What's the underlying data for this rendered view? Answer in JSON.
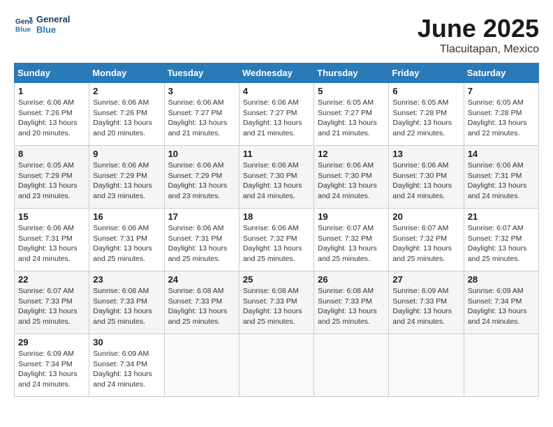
{
  "header": {
    "logo_line1": "General",
    "logo_line2": "Blue",
    "month_year": "June 2025",
    "location": "Tlacuitapan, Mexico"
  },
  "weekdays": [
    "Sunday",
    "Monday",
    "Tuesday",
    "Wednesday",
    "Thursday",
    "Friday",
    "Saturday"
  ],
  "weeks": [
    [
      {
        "day": "1",
        "sunrise": "Sunrise: 6:06 AM",
        "sunset": "Sunset: 7:26 PM",
        "daylight": "Daylight: 13 hours and 20 minutes."
      },
      {
        "day": "2",
        "sunrise": "Sunrise: 6:06 AM",
        "sunset": "Sunset: 7:26 PM",
        "daylight": "Daylight: 13 hours and 20 minutes."
      },
      {
        "day": "3",
        "sunrise": "Sunrise: 6:06 AM",
        "sunset": "Sunset: 7:27 PM",
        "daylight": "Daylight: 13 hours and 21 minutes."
      },
      {
        "day": "4",
        "sunrise": "Sunrise: 6:06 AM",
        "sunset": "Sunset: 7:27 PM",
        "daylight": "Daylight: 13 hours and 21 minutes."
      },
      {
        "day": "5",
        "sunrise": "Sunrise: 6:05 AM",
        "sunset": "Sunset: 7:27 PM",
        "daylight": "Daylight: 13 hours and 21 minutes."
      },
      {
        "day": "6",
        "sunrise": "Sunrise: 6:05 AM",
        "sunset": "Sunset: 7:28 PM",
        "daylight": "Daylight: 13 hours and 22 minutes."
      },
      {
        "day": "7",
        "sunrise": "Sunrise: 6:05 AM",
        "sunset": "Sunset: 7:28 PM",
        "daylight": "Daylight: 13 hours and 22 minutes."
      }
    ],
    [
      {
        "day": "8",
        "sunrise": "Sunrise: 6:05 AM",
        "sunset": "Sunset: 7:29 PM",
        "daylight": "Daylight: 13 hours and 23 minutes."
      },
      {
        "day": "9",
        "sunrise": "Sunrise: 6:06 AM",
        "sunset": "Sunset: 7:29 PM",
        "daylight": "Daylight: 13 hours and 23 minutes."
      },
      {
        "day": "10",
        "sunrise": "Sunrise: 6:06 AM",
        "sunset": "Sunset: 7:29 PM",
        "daylight": "Daylight: 13 hours and 23 minutes."
      },
      {
        "day": "11",
        "sunrise": "Sunrise: 6:06 AM",
        "sunset": "Sunset: 7:30 PM",
        "daylight": "Daylight: 13 hours and 24 minutes."
      },
      {
        "day": "12",
        "sunrise": "Sunrise: 6:06 AM",
        "sunset": "Sunset: 7:30 PM",
        "daylight": "Daylight: 13 hours and 24 minutes."
      },
      {
        "day": "13",
        "sunrise": "Sunrise: 6:06 AM",
        "sunset": "Sunset: 7:30 PM",
        "daylight": "Daylight: 13 hours and 24 minutes."
      },
      {
        "day": "14",
        "sunrise": "Sunrise: 6:06 AM",
        "sunset": "Sunset: 7:31 PM",
        "daylight": "Daylight: 13 hours and 24 minutes."
      }
    ],
    [
      {
        "day": "15",
        "sunrise": "Sunrise: 6:06 AM",
        "sunset": "Sunset: 7:31 PM",
        "daylight": "Daylight: 13 hours and 24 minutes."
      },
      {
        "day": "16",
        "sunrise": "Sunrise: 6:06 AM",
        "sunset": "Sunset: 7:31 PM",
        "daylight": "Daylight: 13 hours and 25 minutes."
      },
      {
        "day": "17",
        "sunrise": "Sunrise: 6:06 AM",
        "sunset": "Sunset: 7:31 PM",
        "daylight": "Daylight: 13 hours and 25 minutes."
      },
      {
        "day": "18",
        "sunrise": "Sunrise: 6:06 AM",
        "sunset": "Sunset: 7:32 PM",
        "daylight": "Daylight: 13 hours and 25 minutes."
      },
      {
        "day": "19",
        "sunrise": "Sunrise: 6:07 AM",
        "sunset": "Sunset: 7:32 PM",
        "daylight": "Daylight: 13 hours and 25 minutes."
      },
      {
        "day": "20",
        "sunrise": "Sunrise: 6:07 AM",
        "sunset": "Sunset: 7:32 PM",
        "daylight": "Daylight: 13 hours and 25 minutes."
      },
      {
        "day": "21",
        "sunrise": "Sunrise: 6:07 AM",
        "sunset": "Sunset: 7:32 PM",
        "daylight": "Daylight: 13 hours and 25 minutes."
      }
    ],
    [
      {
        "day": "22",
        "sunrise": "Sunrise: 6:07 AM",
        "sunset": "Sunset: 7:33 PM",
        "daylight": "Daylight: 13 hours and 25 minutes."
      },
      {
        "day": "23",
        "sunrise": "Sunrise: 6:08 AM",
        "sunset": "Sunset: 7:33 PM",
        "daylight": "Daylight: 13 hours and 25 minutes."
      },
      {
        "day": "24",
        "sunrise": "Sunrise: 6:08 AM",
        "sunset": "Sunset: 7:33 PM",
        "daylight": "Daylight: 13 hours and 25 minutes."
      },
      {
        "day": "25",
        "sunrise": "Sunrise: 6:08 AM",
        "sunset": "Sunset: 7:33 PM",
        "daylight": "Daylight: 13 hours and 25 minutes."
      },
      {
        "day": "26",
        "sunrise": "Sunrise: 6:08 AM",
        "sunset": "Sunset: 7:33 PM",
        "daylight": "Daylight: 13 hours and 25 minutes."
      },
      {
        "day": "27",
        "sunrise": "Sunrise: 6:09 AM",
        "sunset": "Sunset: 7:33 PM",
        "daylight": "Daylight: 13 hours and 24 minutes."
      },
      {
        "day": "28",
        "sunrise": "Sunrise: 6:09 AM",
        "sunset": "Sunset: 7:34 PM",
        "daylight": "Daylight: 13 hours and 24 minutes."
      }
    ],
    [
      {
        "day": "29",
        "sunrise": "Sunrise: 6:09 AM",
        "sunset": "Sunset: 7:34 PM",
        "daylight": "Daylight: 13 hours and 24 minutes."
      },
      {
        "day": "30",
        "sunrise": "Sunrise: 6:09 AM",
        "sunset": "Sunset: 7:34 PM",
        "daylight": "Daylight: 13 hours and 24 minutes."
      },
      null,
      null,
      null,
      null,
      null
    ]
  ]
}
